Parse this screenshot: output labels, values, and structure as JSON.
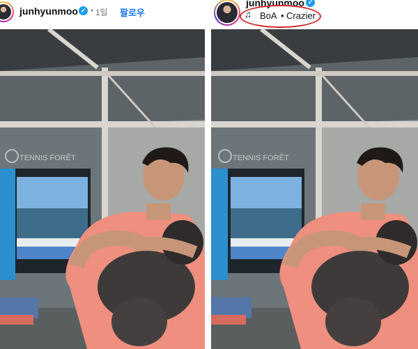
{
  "left_post": {
    "username": "junhyunmoo",
    "verified_glyph": "✓",
    "separator": "•",
    "time": "1일",
    "follow_label": "팔로우",
    "photo_sign": "TENNIS FORÊT"
  },
  "right_post": {
    "username": "junhyunmoo",
    "verified_glyph": "✓",
    "music_icon": "♫",
    "artist": "BoA",
    "separator": "•",
    "song": "Crazier",
    "photo_sign": "TENNIS FORÊT"
  },
  "icons": {
    "verified": "verified-badge-icon",
    "music": "music-note-icon"
  },
  "colors": {
    "accent_blue": "#1877f2",
    "verified_blue": "#1d9bf0",
    "annotation_red": "#d62b2b",
    "shirt_pink": "#ef8f7f"
  }
}
